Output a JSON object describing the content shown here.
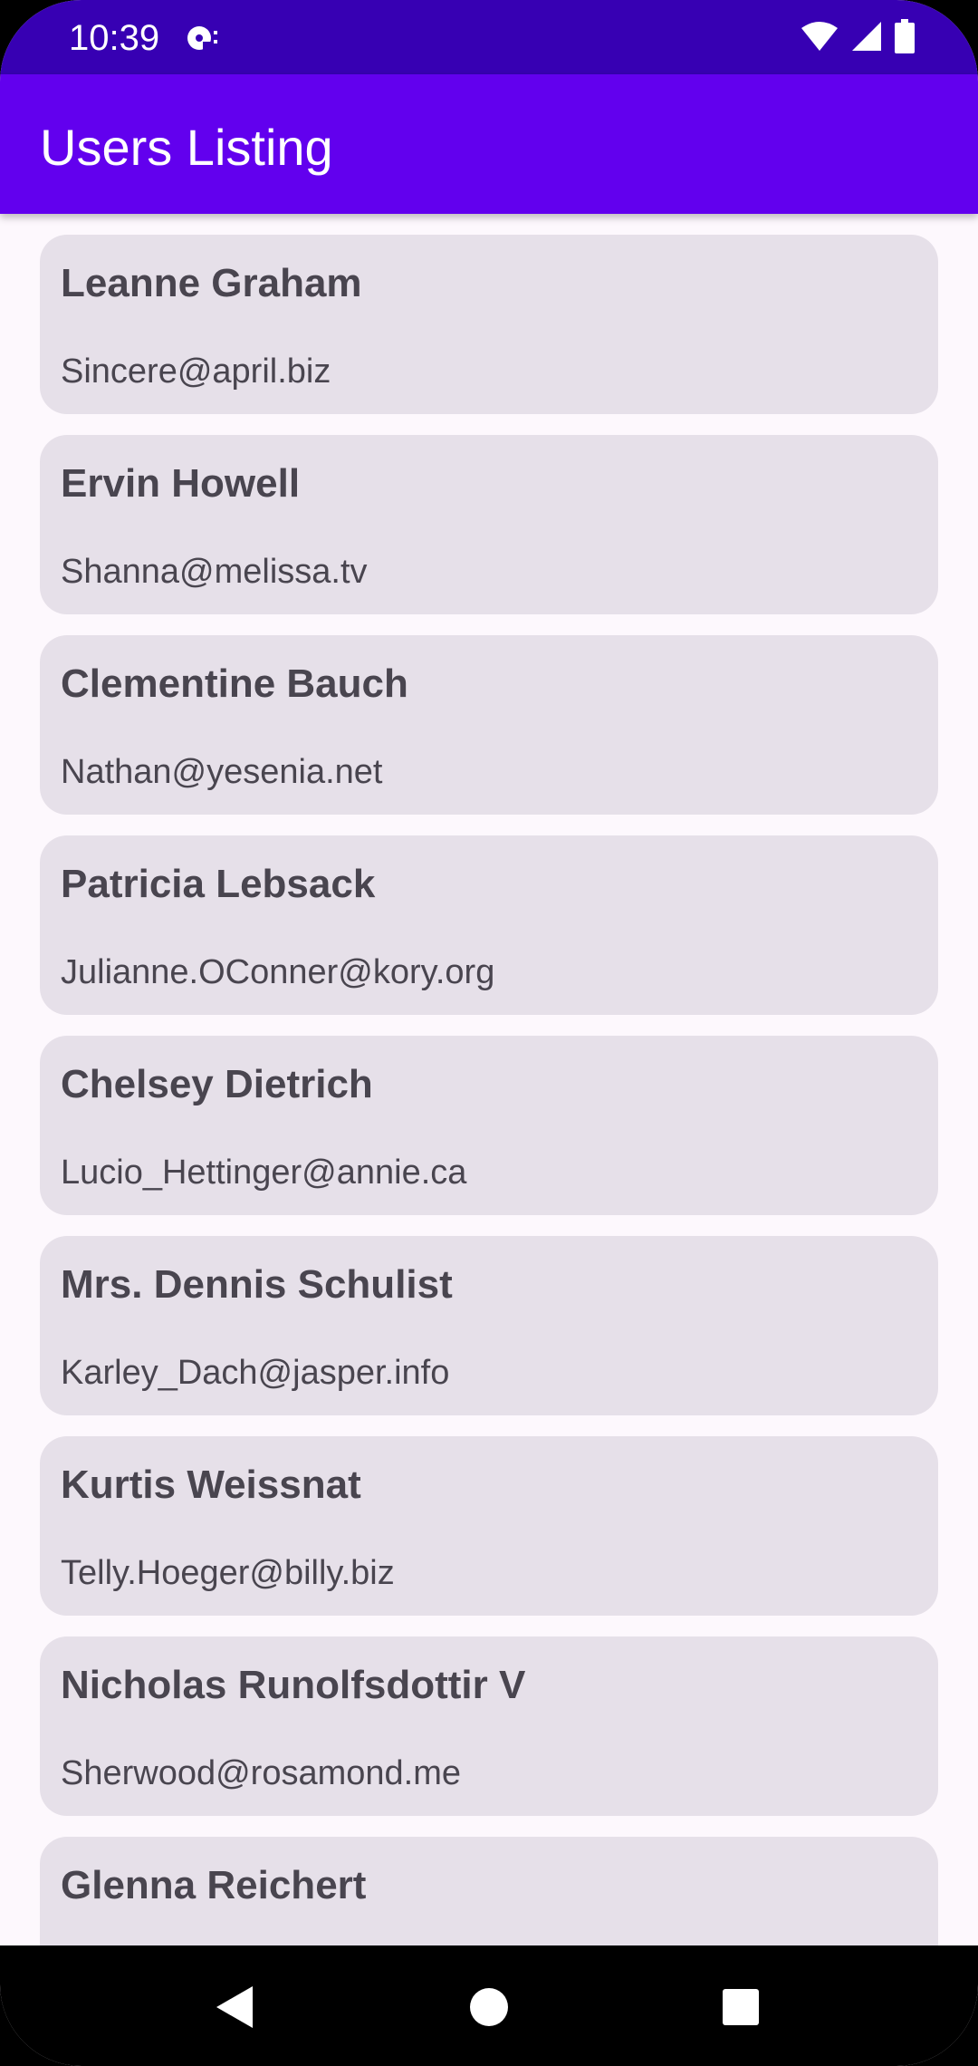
{
  "status_bar": {
    "time": "10:39",
    "icons": [
      "app-notification-icon",
      "wifi-icon",
      "cell-signal-icon",
      "battery-icon"
    ]
  },
  "app_bar": {
    "title": "Users Listing",
    "color": "#6200ee",
    "status_color": "#3700b3"
  },
  "users": [
    {
      "name": "Leanne Graham",
      "email": "Sincere@april.biz"
    },
    {
      "name": "Ervin Howell",
      "email": "Shanna@melissa.tv"
    },
    {
      "name": "Clementine Bauch",
      "email": "Nathan@yesenia.net"
    },
    {
      "name": "Patricia Lebsack",
      "email": "Julianne.OConner@kory.org"
    },
    {
      "name": "Chelsey Dietrich",
      "email": "Lucio_Hettinger@annie.ca"
    },
    {
      "name": "Mrs. Dennis Schulist",
      "email": "Karley_Dach@jasper.info"
    },
    {
      "name": "Kurtis Weissnat",
      "email": "Telly.Hoeger@billy.biz"
    },
    {
      "name": "Nicholas Runolfsdottir V",
      "email": "Sherwood@rosamond.me"
    },
    {
      "name": "Glenna Reichert",
      "email": ""
    }
  ],
  "nav_bar": {
    "buttons": [
      "back-icon",
      "home-icon",
      "recents-icon"
    ]
  }
}
